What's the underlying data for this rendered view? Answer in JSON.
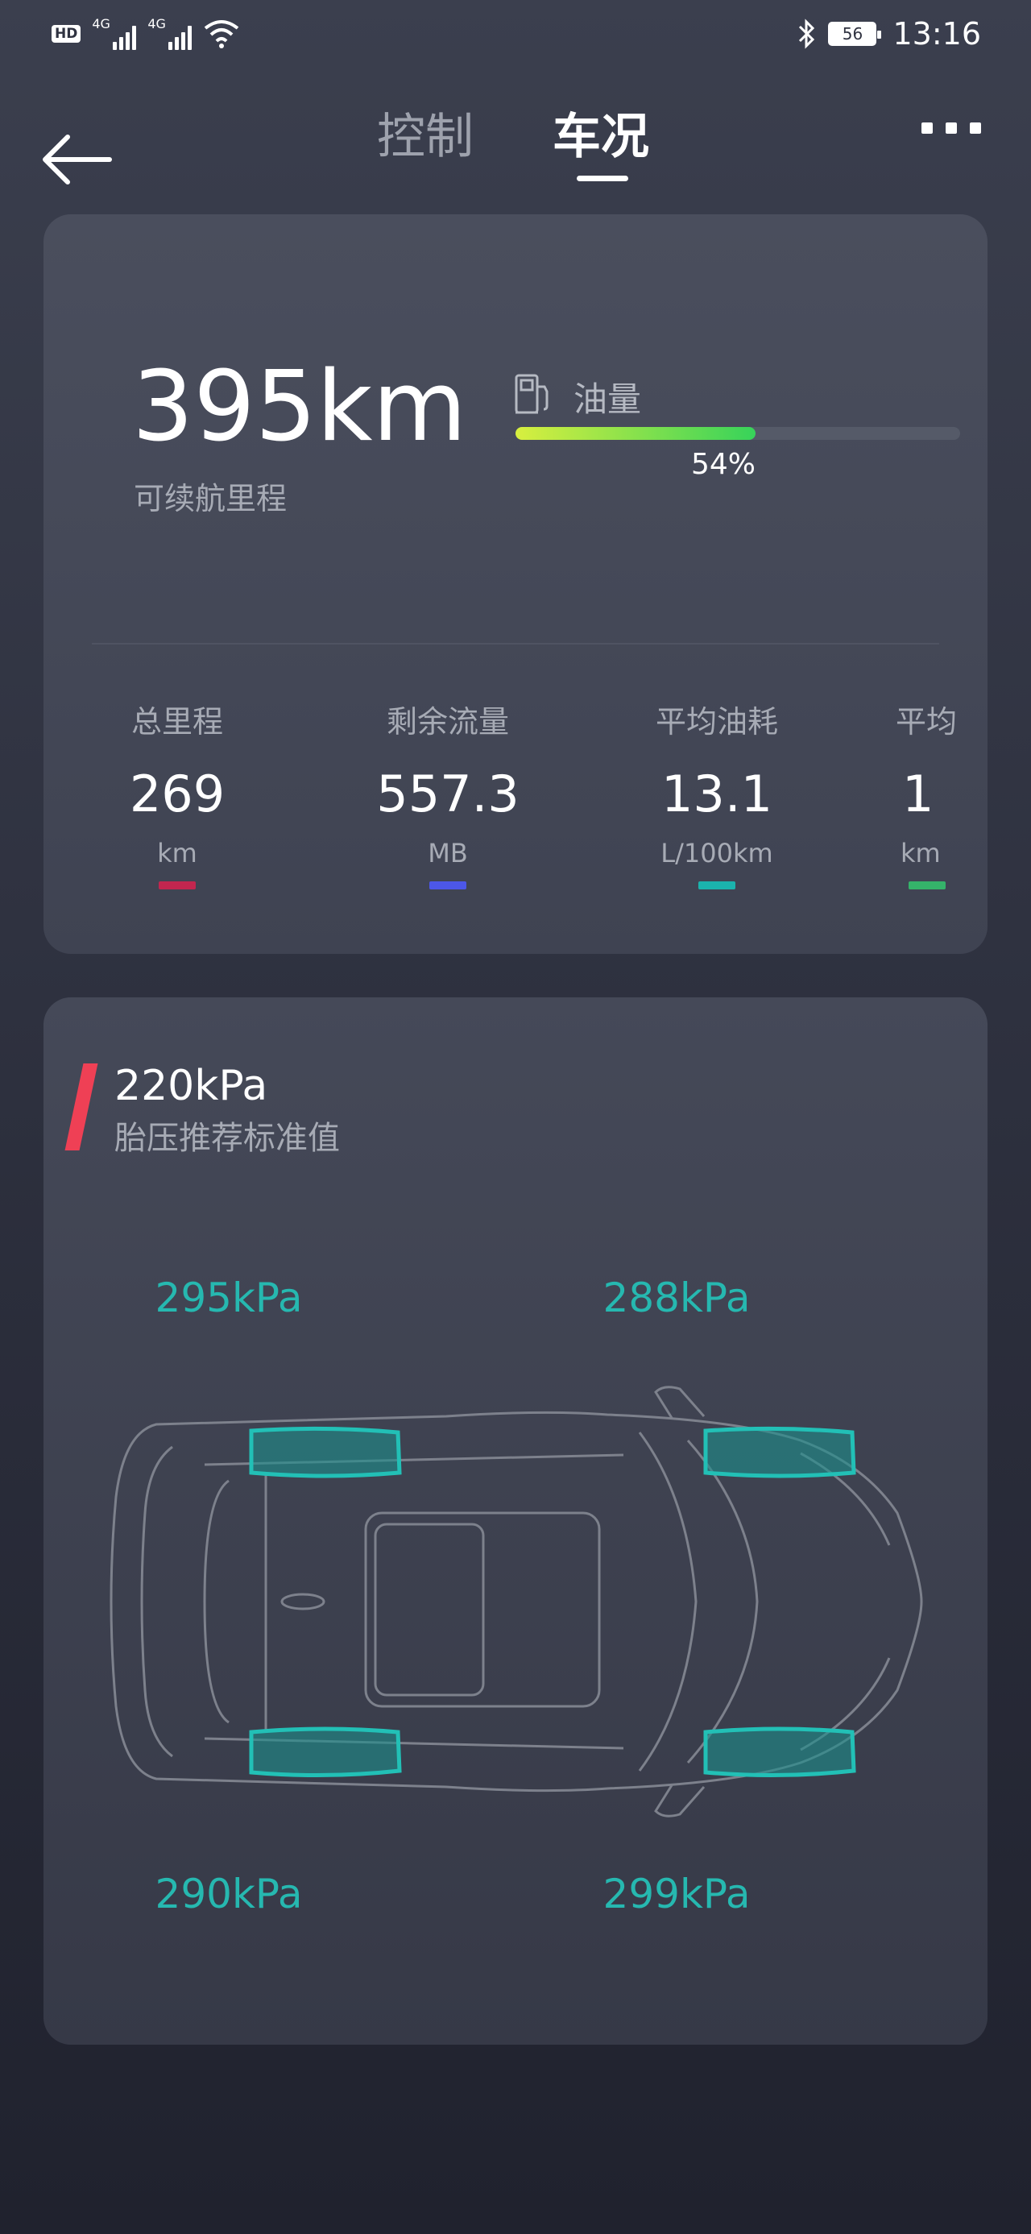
{
  "status_bar": {
    "hd": "HD",
    "signal1": "4G",
    "signal2": "4G",
    "battery": "56",
    "time": "13:16"
  },
  "nav": {
    "tab_control": "控制",
    "tab_status": "车况",
    "active_tab": "车况"
  },
  "range": {
    "value": "395km",
    "label": "可续航里程"
  },
  "fuel": {
    "label": "油量",
    "percent_text": "54%",
    "percent": 54,
    "gradient_start": "#d8ef3f",
    "gradient_end": "#37d35a"
  },
  "stats": [
    {
      "name": "总里程",
      "value": "269",
      "unit": "km",
      "color": "#c2264f"
    },
    {
      "name": "剩余流量",
      "value": "557.3",
      "unit": "MB",
      "color": "#4c57e8"
    },
    {
      "name": "平均油耗",
      "value": "13.1",
      "unit": "L/100km",
      "color": "#1bb3ad"
    },
    {
      "name": "平均",
      "value": "1",
      "unit": "km",
      "color": "#35b36a"
    }
  ],
  "tire": {
    "recommended_value": "220kPa",
    "recommended_label": "胎压推荐标准值",
    "front_left": "295kPa",
    "front_right": "288kPa",
    "rear_left": "290kPa",
    "rear_right": "299kPa",
    "accent": "#26b8b0"
  }
}
